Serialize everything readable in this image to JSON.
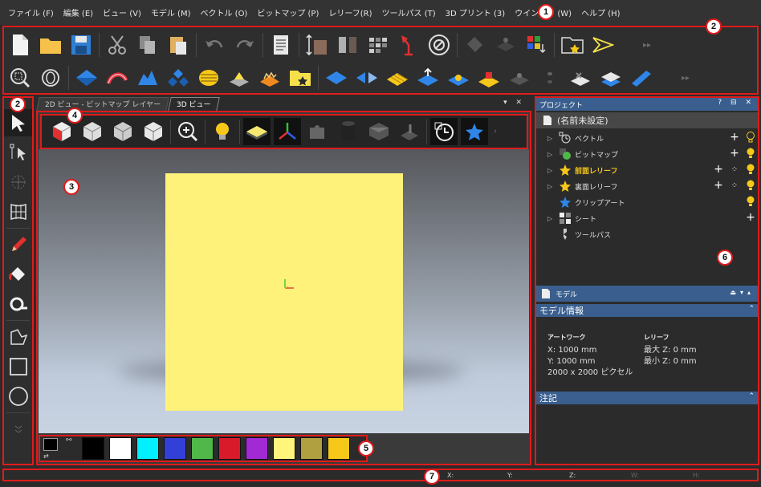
{
  "menubar": {
    "items": [
      {
        "label": "ファイル (F)"
      },
      {
        "label": "編集 (E)"
      },
      {
        "label": "ビュー (V)"
      },
      {
        "label": "モデル (M)"
      },
      {
        "label": "ベクトル (O)"
      },
      {
        "label": "ビットマップ (P)"
      },
      {
        "label": "レリーフ(R)"
      },
      {
        "label": "ツールパス (T)"
      },
      {
        "label": "3D プリント (3)"
      },
      {
        "label": "ウインドウ (W)"
      },
      {
        "label": "ヘルプ (H)"
      }
    ]
  },
  "view_tabs": [
    {
      "label": "2D ビュー - ビットマップ レイヤー"
    },
    {
      "label": "3D ビュー"
    }
  ],
  "view_controls": "▾ ✕",
  "project_panel": {
    "title": "プロジェクト",
    "header_icons": "? ⊟ ✕",
    "root": "(名前未設定)",
    "items": [
      {
        "label": "ベクトル"
      },
      {
        "label": "ビットマップ"
      },
      {
        "label": "前面レリーフ"
      },
      {
        "label": "裏面レリーフ"
      },
      {
        "label": "クリップアート"
      },
      {
        "label": "シート"
      },
      {
        "label": "ツールパス"
      }
    ]
  },
  "model_panel": {
    "title": "モデル",
    "info_header": "モデル情報",
    "artwork": {
      "label": "アートワーク",
      "x": "X: 1000 mm",
      "y": "Y: 1000 mm",
      "pixels": "2000 x 2000 ピクセル"
    },
    "relief": {
      "label": "レリーフ",
      "max_z": "最大 Z: 0 mm",
      "min_z": "最小 Z: 0 mm"
    },
    "notes_header": "注記"
  },
  "palette": {
    "colors": [
      "#000000",
      "#ffffff",
      "#00f0ff",
      "#3340d8",
      "#4fb848",
      "#d91a2a",
      "#a22ad4",
      "#fff57a",
      "#b0a040",
      "#f6c81a"
    ]
  },
  "statusbar": {
    "x": "X:",
    "y": "Y:",
    "z": "Z:",
    "w": "W:",
    "h": "H:"
  },
  "callouts": [
    "1",
    "2",
    "2",
    "3",
    "4",
    "5",
    "6",
    "7"
  ]
}
